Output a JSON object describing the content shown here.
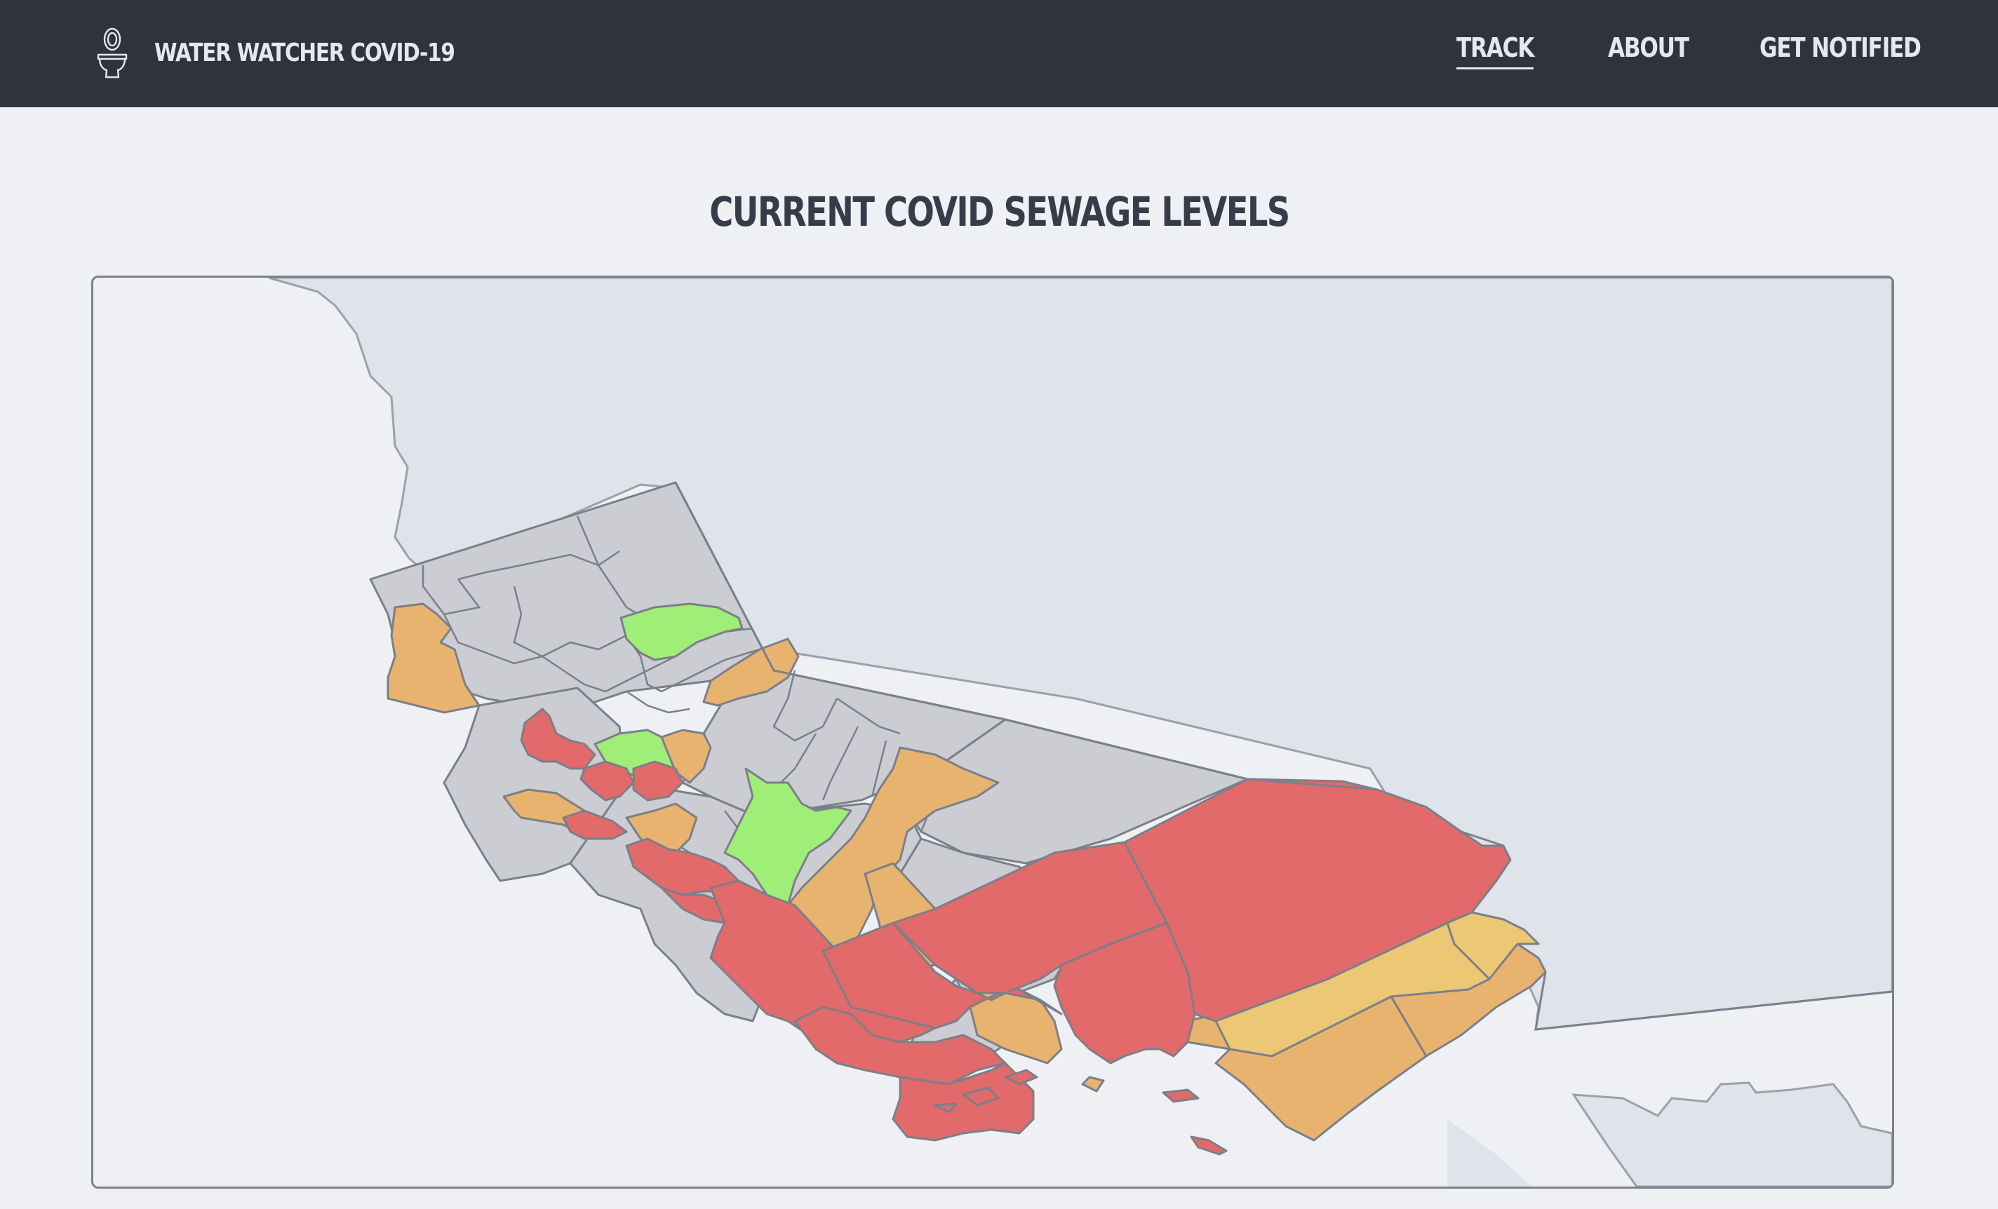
{
  "app": {
    "brand_title": "WATER WATCHER COVID-19",
    "brand_icon": "toilet-icon"
  },
  "nav": {
    "items": [
      {
        "label": "TRACK",
        "active": true
      },
      {
        "label": "ABOUT",
        "active": false
      },
      {
        "label": "GET NOTIFIED",
        "active": false
      }
    ]
  },
  "main": {
    "heading": "CURRENT COVID SEWAGE LEVELS"
  },
  "map": {
    "region": "California",
    "level_colors": {
      "high": "#e26a6a",
      "elevated": "#e8b36e",
      "moderate": "#ecc874",
      "low": "#9fee78",
      "no_data": "#cbcdd2"
    },
    "land_background": "#dfe3ea",
    "ocean_background": "#eef0f3"
  }
}
